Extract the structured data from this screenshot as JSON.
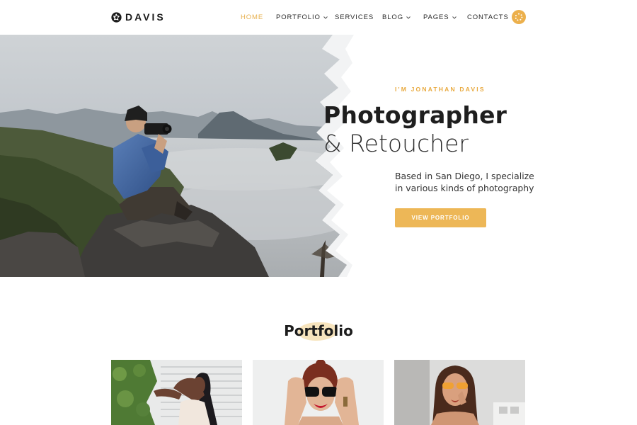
{
  "brand": {
    "name": "DAVIS",
    "logo_icon": "aperture-icon"
  },
  "nav": {
    "items": [
      {
        "label": "HOME",
        "active": true,
        "has_dropdown": false
      },
      {
        "label": "PORTFOLIO",
        "active": false,
        "has_dropdown": true
      },
      {
        "label": "SERVICES",
        "active": false,
        "has_dropdown": false
      },
      {
        "label": "BLOG",
        "active": false,
        "has_dropdown": true
      },
      {
        "label": "PAGES",
        "active": false,
        "has_dropdown": true
      },
      {
        "label": "CONTACTS",
        "active": false,
        "has_dropdown": false
      }
    ],
    "menu_button_icon": "dots-grid-icon"
  },
  "hero": {
    "kicker": "I'M JONATHAN DAVIS",
    "headline": "Photographer",
    "subline": "& Retoucher",
    "description": "Based in San Diego, I specialize in various kinds of photography",
    "cta_label": "VIEW PORTFOLIO",
    "image_subject": "photographer-on-mountain-photo"
  },
  "portfolio": {
    "title": "Portfolio",
    "items": [
      {
        "name": "portfolio-photo-woman-plants"
      },
      {
        "name": "portfolio-photo-woman-sunglasses"
      },
      {
        "name": "portfolio-photo-woman-orange-glasses"
      }
    ]
  },
  "colors": {
    "accent": "#ecb04c",
    "text": "#1e1e1e",
    "background": "#ffffff"
  }
}
